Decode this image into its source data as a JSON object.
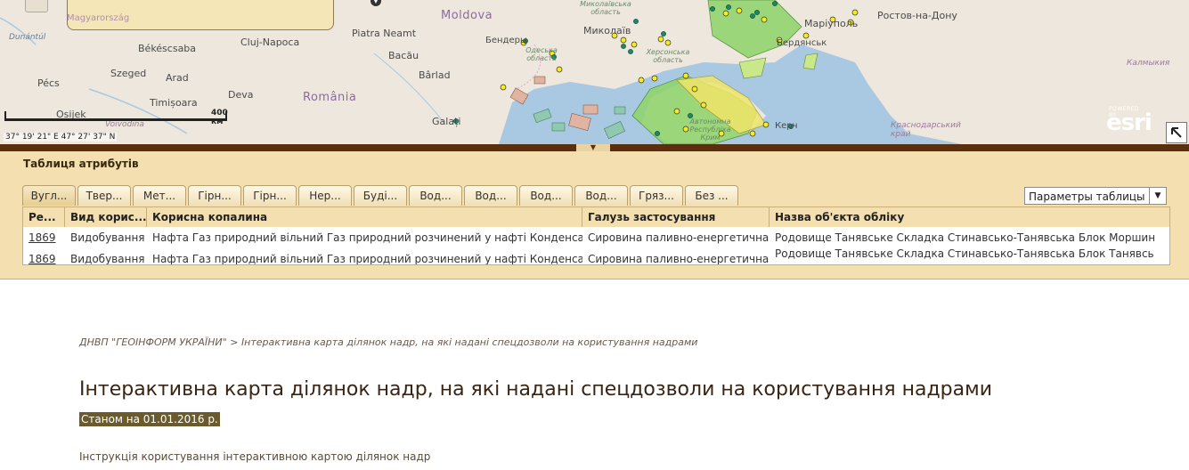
{
  "map": {
    "labels": {
      "moldova": "Moldova",
      "romania": "România",
      "magyarorszag": "Magyarország",
      "dunantul": "Dunántúl",
      "bekescsaba": "Békéscsaba",
      "cluj": "Cluj-Napoca",
      "piatra": "Piatra Neamt",
      "bacau": "Bacău",
      "barlad": "Bârlad",
      "szeged": "Szeged",
      "arad": "Arad",
      "pecs": "Pécs",
      "deva": "Deva",
      "timisoara": "Timișoara",
      "osijek": "Osijek",
      "vojvodina": "Voivodina",
      "galati": "Galați",
      "bender": "Бендеры",
      "mykolaiv": "Миколаїв",
      "mykolaiv_obl": "Миколаївська область",
      "odesa_obl": "Одеська область",
      "kherson_obl": "Херсонська область",
      "zap_obl": "Запорізька область",
      "berdyansk": "Бердянськ",
      "mariupol": "Маріуполь",
      "rostov": "Ростов-на-Дону",
      "kalmykia": "Калмыкия",
      "krasnodar": "Краснодарський край",
      "crimea": "Автономна Республіка Крим",
      "kalush": "Керч"
    },
    "scale_label": "400 км",
    "coords": "37° 19' 21\" E 47° 27' 37\" N",
    "esri_powered": "POWERED BY",
    "esri_logo": "esri"
  },
  "attr_table": {
    "title": "Таблиця атрибутів",
    "tabs": [
      {
        "label": "Вугл..."
      },
      {
        "label": "Твер..."
      },
      {
        "label": "Мет..."
      },
      {
        "label": "Гірн..."
      },
      {
        "label": "Гірн..."
      },
      {
        "label": "Нер..."
      },
      {
        "label": "Буді..."
      },
      {
        "label": "Вод..."
      },
      {
        "label": "Вод..."
      },
      {
        "label": "Вод..."
      },
      {
        "label": "Вод..."
      },
      {
        "label": "Гряз..."
      },
      {
        "label": "Без ..."
      }
    ],
    "params_label": "Параметры таблицы",
    "columns": [
      "Ре...",
      "Вид корис...",
      "Корисна копалина",
      "Галузь застосування",
      "Назва об'єкта обліку"
    ],
    "rows": [
      [
        "1869",
        "Видобування",
        "Нафта Газ природний вільний Газ природний розчинений у нафті Конденсат",
        "Сировина паливно-енергетична",
        "Родовище Танявське Складка Стинавсько-Танявська Блок Моршинсь"
      ],
      [
        "1869",
        "Видобування",
        "Нафта Газ природний вільний Газ природний розчинений у нафті Конденсат",
        "Сировина паливно-енергетична",
        "Родовище Танявське Складка Стинавсько-Танявська Блок Танявський"
      ]
    ]
  },
  "page": {
    "breadcrumb_home": "ДНВП \"ГЕОІНФОРМ УКРАЇНИ\"",
    "breadcrumb_sep": ">",
    "breadcrumb_current": "Інтерактивна карта ділянок надр, на які надані спецдозволи на користування надрами",
    "title": "Інтерактивна карта ділянок надр, на які надані спецдозволи на користування надрами",
    "date_badge": "Станом на 01.01.2016 р.",
    "instruction": "Інструкція користування інтерактивною картою ділянок надр"
  }
}
